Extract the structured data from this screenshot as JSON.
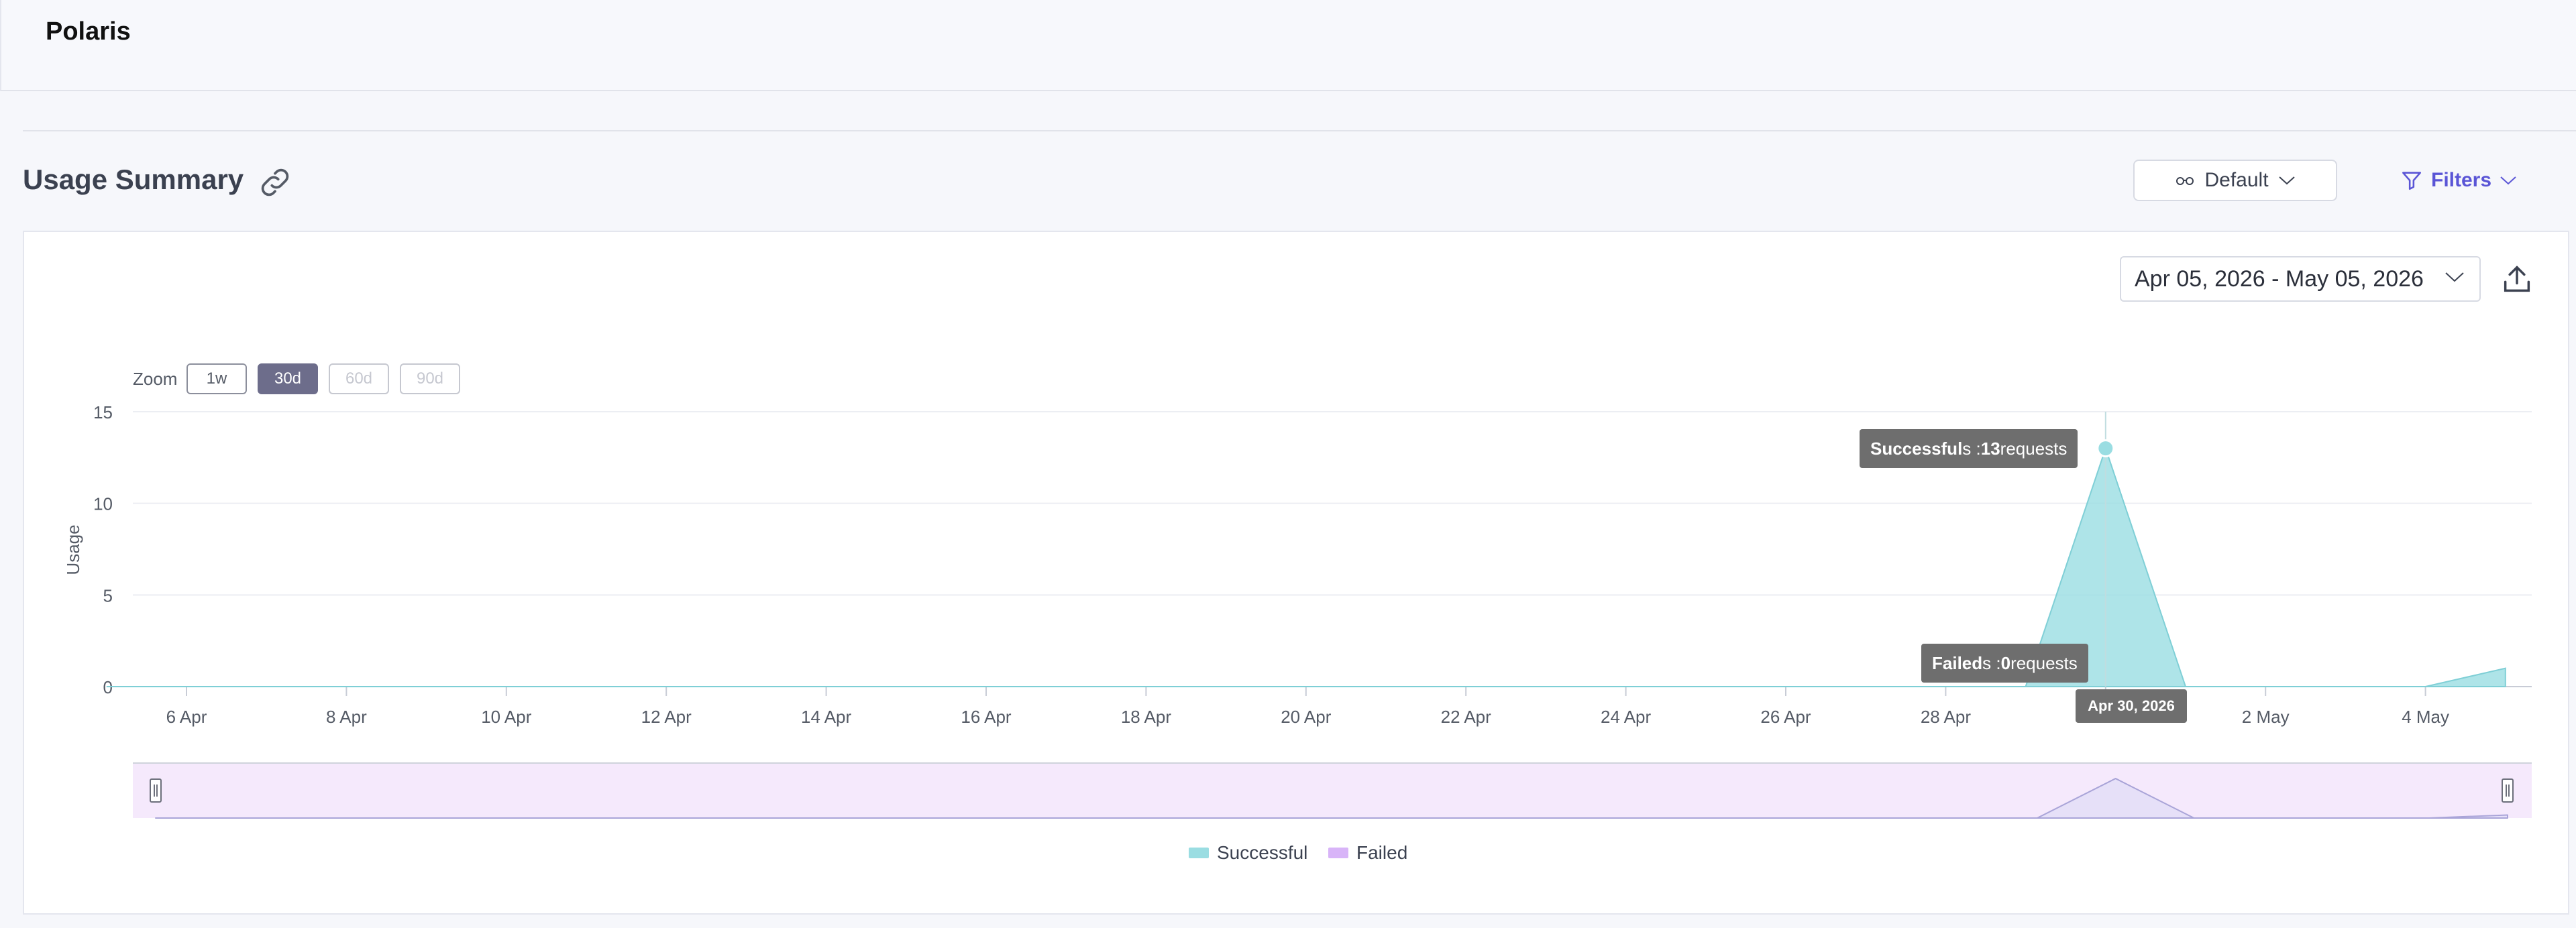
{
  "app": {
    "title": "Polaris"
  },
  "section": {
    "title": "Usage Summary"
  },
  "toolbar": {
    "view_label": "Default",
    "filters_label": "Filters"
  },
  "date_range": {
    "label": "Apr 05, 2026 - May 05, 2026"
  },
  "zoom": {
    "label": "Zoom",
    "options": [
      {
        "label": "1w",
        "state": "normal"
      },
      {
        "label": "30d",
        "state": "active"
      },
      {
        "label": "60d",
        "state": "disabled"
      },
      {
        "label": "90d",
        "state": "disabled"
      }
    ]
  },
  "tooltips": {
    "successful": {
      "series": "Successful",
      "suffix": "s : ",
      "value": "13",
      "unit": " requests"
    },
    "failed": {
      "series": "Failed",
      "suffix": "s : ",
      "value": "0",
      "unit": " requests"
    },
    "date": "Apr 30, 2026"
  },
  "colors": {
    "successful": "#9adde2",
    "failed": "#d8b4f8",
    "accent": "#5a55d6"
  },
  "chart_data": {
    "type": "area",
    "ylabel": "Usage",
    "ylim": [
      0,
      15
    ],
    "y_ticks": [
      "0",
      "5",
      "10",
      "15"
    ],
    "x_ticks": [
      "6 Apr",
      "8 Apr",
      "10 Apr",
      "12 Apr",
      "14 Apr",
      "16 Apr",
      "18 Apr",
      "20 Apr",
      "22 Apr",
      "24 Apr",
      "26 Apr",
      "28 Apr",
      "",
      "2 May",
      "4 May"
    ],
    "x": [
      "2026-04-05",
      "2026-04-06",
      "2026-04-07",
      "2026-04-08",
      "2026-04-09",
      "2026-04-10",
      "2026-04-11",
      "2026-04-12",
      "2026-04-13",
      "2026-04-14",
      "2026-04-15",
      "2026-04-16",
      "2026-04-17",
      "2026-04-18",
      "2026-04-19",
      "2026-04-20",
      "2026-04-21",
      "2026-04-22",
      "2026-04-23",
      "2026-04-24",
      "2026-04-25",
      "2026-04-26",
      "2026-04-27",
      "2026-04-28",
      "2026-04-29",
      "2026-04-30",
      "2026-05-01",
      "2026-05-02",
      "2026-05-03",
      "2026-05-04",
      "2026-05-05"
    ],
    "series": [
      {
        "name": "Successful",
        "values": [
          0,
          0,
          0,
          0,
          0,
          0,
          0,
          0,
          0,
          0,
          0,
          0,
          0,
          0,
          0,
          0,
          0,
          0,
          0,
          0,
          0,
          0,
          0,
          0,
          0,
          13,
          0,
          0,
          0,
          0,
          1
        ]
      },
      {
        "name": "Failed",
        "values": [
          0,
          0,
          0,
          0,
          0,
          0,
          0,
          0,
          0,
          0,
          0,
          0,
          0,
          0,
          0,
          0,
          0,
          0,
          0,
          0,
          0,
          0,
          0,
          0,
          0,
          0,
          0,
          0,
          0,
          0,
          0
        ]
      }
    ],
    "legend": [
      "Successful",
      "Failed"
    ]
  }
}
